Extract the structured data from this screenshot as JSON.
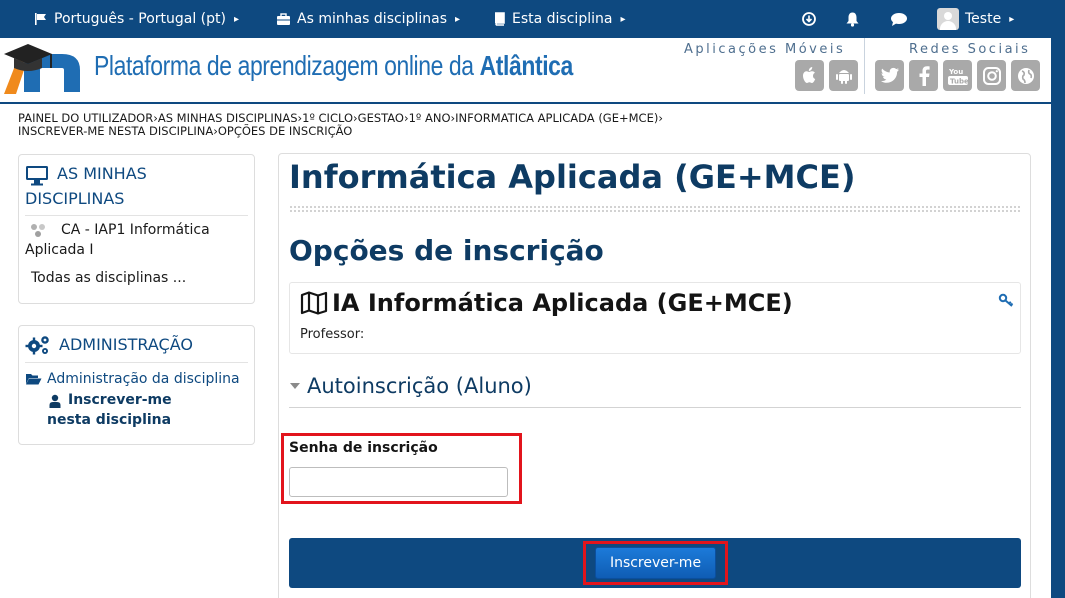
{
  "topnav": {
    "language": "Português - Portugal (pt)",
    "my_courses": "As minhas disciplinas",
    "this_course": "Esta disciplina",
    "user": "Teste"
  },
  "header": {
    "brand_prefix": "Plataforma de aprendizagem online da ",
    "brand_bold": "Atlântica",
    "mobile_label": "Aplicações Móveis",
    "social_label": "Redes Sociais",
    "mobile_icons": [
      "apple-icon",
      "android-icon"
    ],
    "social_icons": [
      "twitter-icon",
      "facebook-icon",
      "youtube-icon",
      "instagram-icon",
      "globe-icon"
    ]
  },
  "breadcrumb": {
    "items": [
      "Painel do utilizador",
      "As minhas disciplinas",
      "1º Ciclo",
      "Gestao",
      "1º Ano",
      "Informatica Aplicada (GE+MCE)",
      "Inscrever-me nesta disciplina",
      "Opções de inscrição"
    ],
    "separator": "›"
  },
  "sidebar": {
    "my_courses": {
      "title_line1": "AS MINHAS",
      "title_line2": "DISCIPLINAS",
      "course": "CA - IAP1 Informática Aplicada I",
      "all_courses": "Todas as disciplinas ..."
    },
    "admin": {
      "title": "ADMINISTRAÇÃO",
      "course_admin": "Administração da disciplina",
      "enrol_me": "Inscrever-me nesta disciplina"
    }
  },
  "main": {
    "course_heading": "Informática Aplicada (GE+MCE)",
    "options_heading": "Opções de inscrição",
    "coursebox_title": "IA Informática Aplicada (GE+MCE)",
    "teacher_label": "Professor:",
    "method": "Autoinscrição (Aluno)",
    "key_label": "Senha de inscrição",
    "key_value": "",
    "submit": "Inscrever-me"
  },
  "colors": {
    "nav_blue": "#0e4980",
    "heading_blue": "#0e3b63",
    "button_blue": "#1569c7",
    "highlight_red": "#e2141c"
  }
}
